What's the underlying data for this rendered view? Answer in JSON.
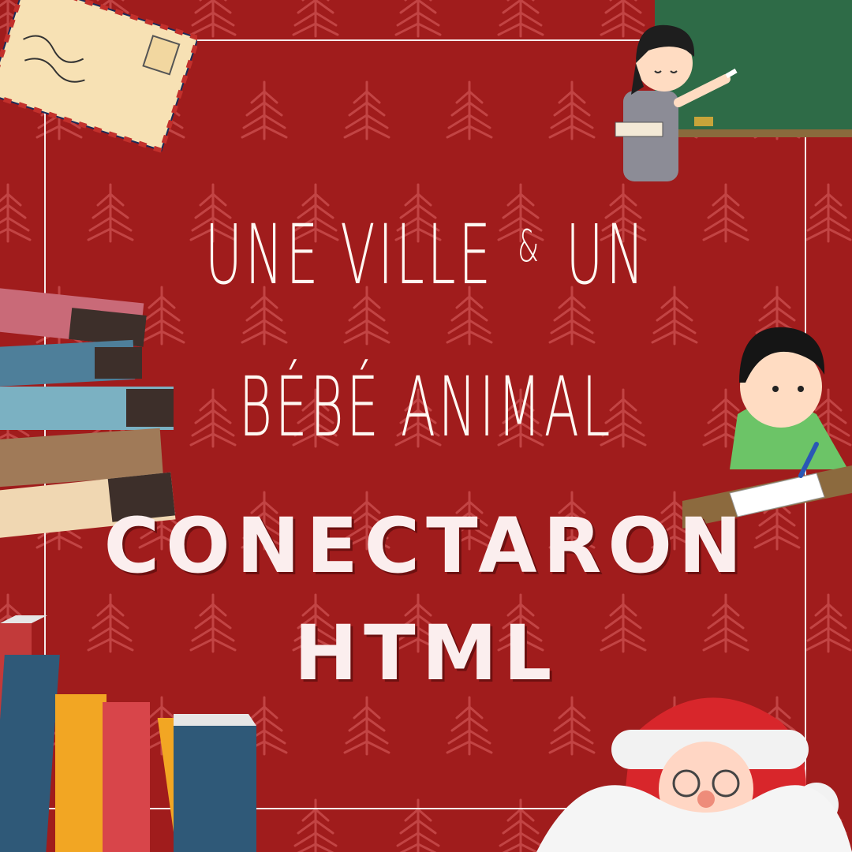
{
  "poster": {
    "line1": "UNE VILLE",
    "amp": "&",
    "line1b": "UN",
    "line2": "BÉBÉ ANIMAL",
    "line3": "CONECTARON",
    "line4": "HTML"
  },
  "colors": {
    "background": "#a01c1c",
    "pattern_tree": "#c24444",
    "frame": "#f6eaea",
    "text": "#fff7f2"
  },
  "decorations": [
    "envelope",
    "teacher-at-chalkboard",
    "stack-of-books",
    "student-writing",
    "standing-books",
    "santa-claus"
  ]
}
